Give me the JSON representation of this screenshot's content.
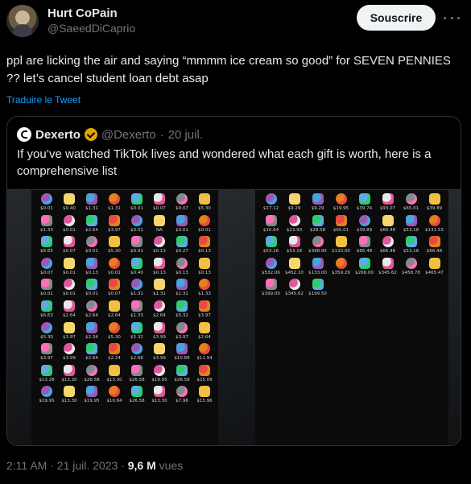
{
  "author": {
    "name": "Hurt CoPain",
    "handle": "@SaeedDiCaprio",
    "follow_label": "Souscrire"
  },
  "tweet": {
    "text": "ppl are licking the air and saying “mmmm ice cream so good” for SEVEN PENNIES ?? let’s cancel student loan debt asap",
    "translate_label": "Traduire le Tweet",
    "time": "2:11 AM",
    "date": "21 juil. 2023",
    "views_count": "9,6 M",
    "views_label": "vues"
  },
  "quoted": {
    "name": "Dexerto",
    "handle": "@Dexerto",
    "date": "20 juil.",
    "text": "If you’ve watched TikTok lives and wondered what each gift is worth, here is a comprehensive list",
    "gift_prices_left": [
      "$0.01",
      "$0.40",
      "$1.31",
      "$1.31",
      "$0.01",
      "$0.07",
      "$0.07",
      "$5.30",
      "$1.33",
      "$0.01",
      "$2.64",
      "$3.97",
      "$0.01",
      "NA",
      "$0.01",
      "$0.01",
      "$6.65",
      "$0.07",
      "$0.01",
      "$5.30",
      "$0.01",
      "$0.13",
      "$0.27",
      "$0.13",
      "$0.07",
      "$0.01",
      "$0.13",
      "$0.01",
      "$0.40",
      "$0.13",
      "$0.13",
      "$0.13",
      "$0.01",
      "$0.01",
      "$0.01",
      "$0.07",
      "$1.31",
      "$1.31",
      "$1.31",
      "$1.33",
      "$6.63",
      "$2.64",
      "$2.64",
      "$2.64",
      "$1.33",
      "$2.64",
      "$5.32",
      "$3.97",
      "$5.30",
      "$3.97",
      "$2.34",
      "$5.30",
      "$5.32",
      "$3.99",
      "$3.97",
      "$2.64",
      "$3.97",
      "$3.99",
      "$2.64",
      "$2.24",
      "$2.66",
      "$3.99",
      "$10.88",
      "$11.94",
      "$13.28",
      "$13.30",
      "$26.58",
      "$13.30",
      "$26.58",
      "$19.95",
      "$26.58",
      "$25.09",
      "$19.95",
      "$13.30",
      "$19.95",
      "$10.64",
      "$26.58",
      "$13.30",
      "$7.96",
      "$15.96"
    ],
    "gift_prices_right": [
      "$17.12",
      "$9.29",
      "$9.29",
      "$19.95",
      "$39.74",
      "$93.07",
      "$65.01",
      "$39.89",
      "$10.64",
      "$23.93",
      "$28.58",
      "$65.01",
      "$39.89",
      "$66.48",
      "$53.18",
      "$131.53",
      "$53.16",
      "$53.18",
      "$398.95",
      "$133.00",
      "$66.48",
      "$66.48",
      "$53.18",
      "$66.48",
      "$532.06",
      "$452.10",
      "$133.00",
      "$359.29",
      "$266.00",
      "$345.62",
      "$458.78",
      "$465.47",
      "$399.00",
      "$345.62",
      "$199.50"
    ],
    "gift_colors": [
      "#e0569a",
      "#4aa3e0",
      "#f0c040",
      "#9b59b6",
      "#e8e8e8",
      "#2ecc71",
      "#e67e22",
      "#ff6fb5",
      "#f5d76e",
      "#7f8c8d",
      "#e74c3c",
      "#5dade2"
    ]
  },
  "colors": {
    "accent": "#1d9bf0",
    "background": "#000000",
    "text": "#e7e9ea",
    "muted": "#71767b",
    "verified": "#e0a800"
  }
}
